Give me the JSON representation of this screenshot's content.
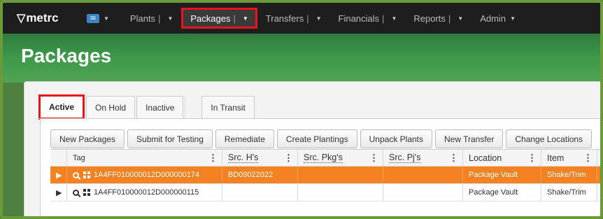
{
  "navbar": {
    "logo": "metrc",
    "items": [
      {
        "label": "Plants"
      },
      {
        "label": "Packages"
      },
      {
        "label": "Transfers"
      },
      {
        "label": "Financials"
      },
      {
        "label": "Reports"
      },
      {
        "label": "Admin"
      }
    ],
    "active_item": "Packages"
  },
  "page": {
    "title": "Packages"
  },
  "tabs": [
    {
      "label": "Active",
      "active": true
    },
    {
      "label": "On Hold"
    },
    {
      "label": "Inactive"
    },
    {
      "label": "In Transit"
    }
  ],
  "toolbar": [
    "New Packages",
    "Submit for Testing",
    "Remediate",
    "Create Plantings",
    "Unpack Plants",
    "New Transfer",
    "Change Locations"
  ],
  "grid": {
    "columns": [
      "Tag",
      "Src. H's",
      "Src. Pkg's",
      "Src. Pj's",
      "Location",
      "Item"
    ],
    "rows": [
      {
        "tag": "1A4FF010000012D000000174",
        "src_h": "BD09022022",
        "src_pkg": "",
        "src_pj": "",
        "location": "Package Vault",
        "item": "Shake/Trim",
        "selected": true
      },
      {
        "tag": "1A4FF010000012D000000115",
        "src_h": "",
        "src_pkg": "",
        "src_pj": "",
        "location": "Package Vault",
        "item": "Shake/Trim",
        "selected": false
      }
    ]
  },
  "colors": {
    "accent_orange": "#f58220",
    "highlight_red": "#e8161b",
    "header_green": "#3e9a4a",
    "navbar": "#1e1e1e"
  }
}
